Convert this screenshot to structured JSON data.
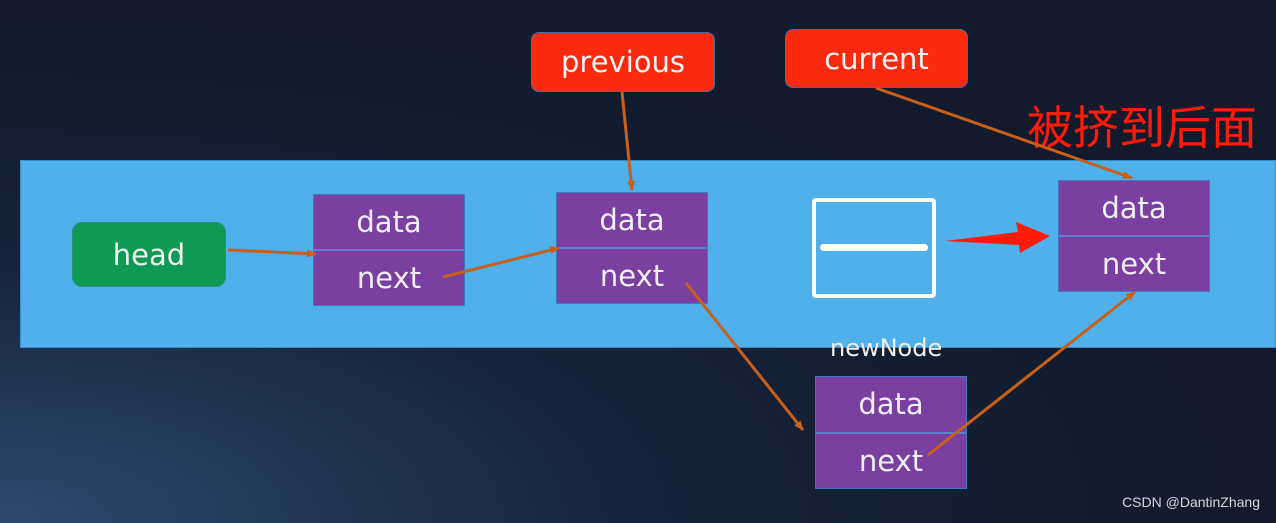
{
  "pointers": {
    "previous": "previous",
    "current": "current",
    "head": "head"
  },
  "node_fields": {
    "data": "data",
    "next": "next"
  },
  "new_node_label": "newNode",
  "annotation": "被挤到后面",
  "watermark": "CSDN @DantinZhang",
  "colors": {
    "band": "#4fb0eb",
    "node": "#7a3fa0",
    "pointer": "#fb2a0f",
    "head": "#0e9a52",
    "link_arrow": "#c8601a",
    "annotation": "#ff1a0a"
  }
}
